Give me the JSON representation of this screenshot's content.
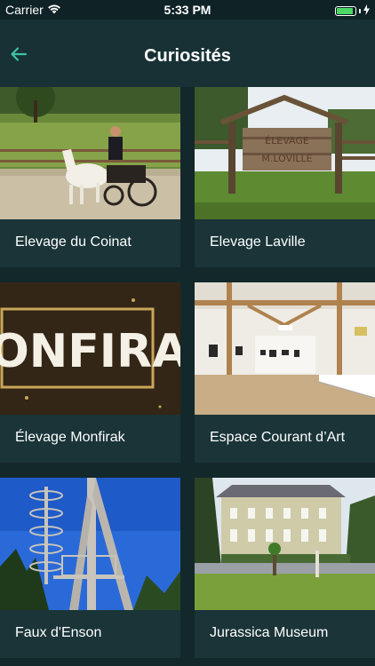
{
  "status_bar": {
    "carrier": "Carrier",
    "time": "5:33 PM",
    "battery_level": 0.9,
    "battery_color": "#4cd964"
  },
  "nav": {
    "title": "Curiosités",
    "back_icon": "arrow-left-icon",
    "accent_color": "#3ec2a6"
  },
  "cards": [
    {
      "label": "Elevage du Coinat"
    },
    {
      "label": "Elevage Laville",
      "sign_text": "ÉLEVAGE M.LOVILLE"
    },
    {
      "label": "Élevage Monfirak",
      "photo_text": "ONFIRA"
    },
    {
      "label": "Espace Courant d’Art"
    },
    {
      "label": "Faux d'Enson"
    },
    {
      "label": "Jurassica Museum"
    }
  ]
}
